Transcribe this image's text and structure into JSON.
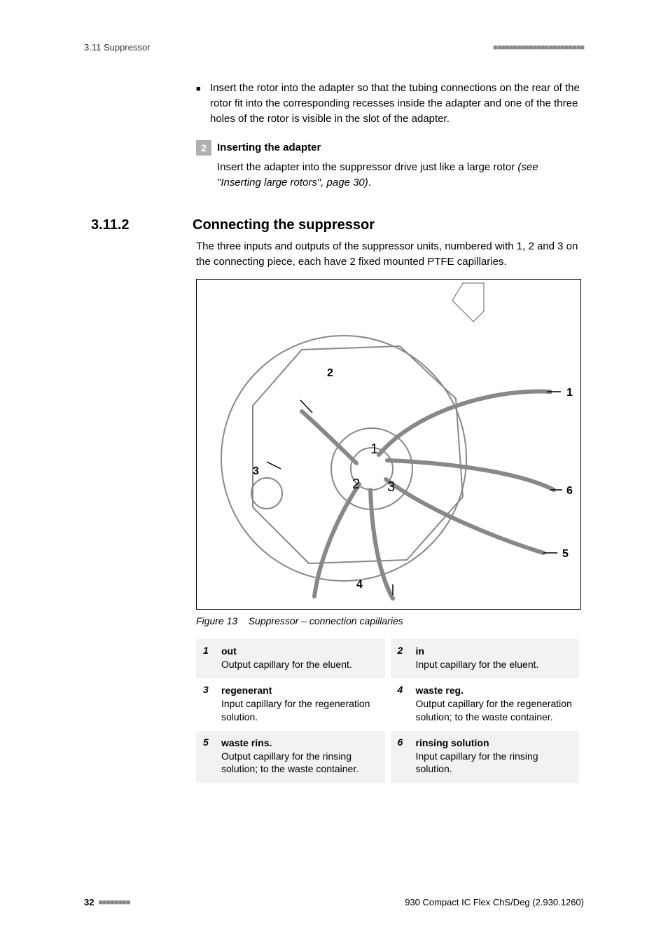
{
  "header": {
    "section": "3.11 Suppressor",
    "squares": "■■■■■■■■■■■■■■■■■■■■■■■"
  },
  "bullet": {
    "text": "Insert the rotor into the adapter so that the tubing connections on the rear of the rotor fit into the corresponding recesses inside the adapter and one of the three holes of the rotor is visible in the slot of the adapter."
  },
  "step": {
    "num": "2",
    "title": "Inserting the adapter",
    "body_plain": "Insert the adapter into the suppressor drive just like a large rotor ",
    "body_italic": "(see \"Inserting large rotors\", page 30)",
    "body_end": "."
  },
  "section": {
    "num": "3.11.2",
    "title": "Connecting the suppressor",
    "para": "The three inputs and outputs of the suppressor units, numbered with 1, 2 and 3 on the connecting piece, each have 2 fixed mounted PTFE capillaries."
  },
  "figure": {
    "caption_label": "Figure 13",
    "caption_text": "Suppressor – connection capillaries",
    "callouts": [
      "1",
      "2",
      "3",
      "4",
      "5",
      "6"
    ],
    "inner_labels": [
      "1",
      "2",
      "3"
    ]
  },
  "legend": [
    [
      {
        "num": "1",
        "term": "out",
        "desc": "Output capillary for the eluent."
      },
      {
        "num": "2",
        "term": "in",
        "desc": "Input capillary for the eluent."
      }
    ],
    [
      {
        "num": "3",
        "term": "regenerant",
        "desc": "Input capillary for the regeneration solution."
      },
      {
        "num": "4",
        "term": "waste reg.",
        "desc": "Output capillary for the regeneration solution; to the waste container."
      }
    ],
    [
      {
        "num": "5",
        "term": "waste rins.",
        "desc": "Output capillary for the rinsing solution; to the waste container."
      },
      {
        "num": "6",
        "term": "rinsing solution",
        "desc": "Input capillary for the rinsing solution."
      }
    ]
  ],
  "footer": {
    "page": "32",
    "squares": "■■■■■■■■",
    "doc": "930 Compact IC Flex ChS/Deg (2.930.1260)"
  }
}
